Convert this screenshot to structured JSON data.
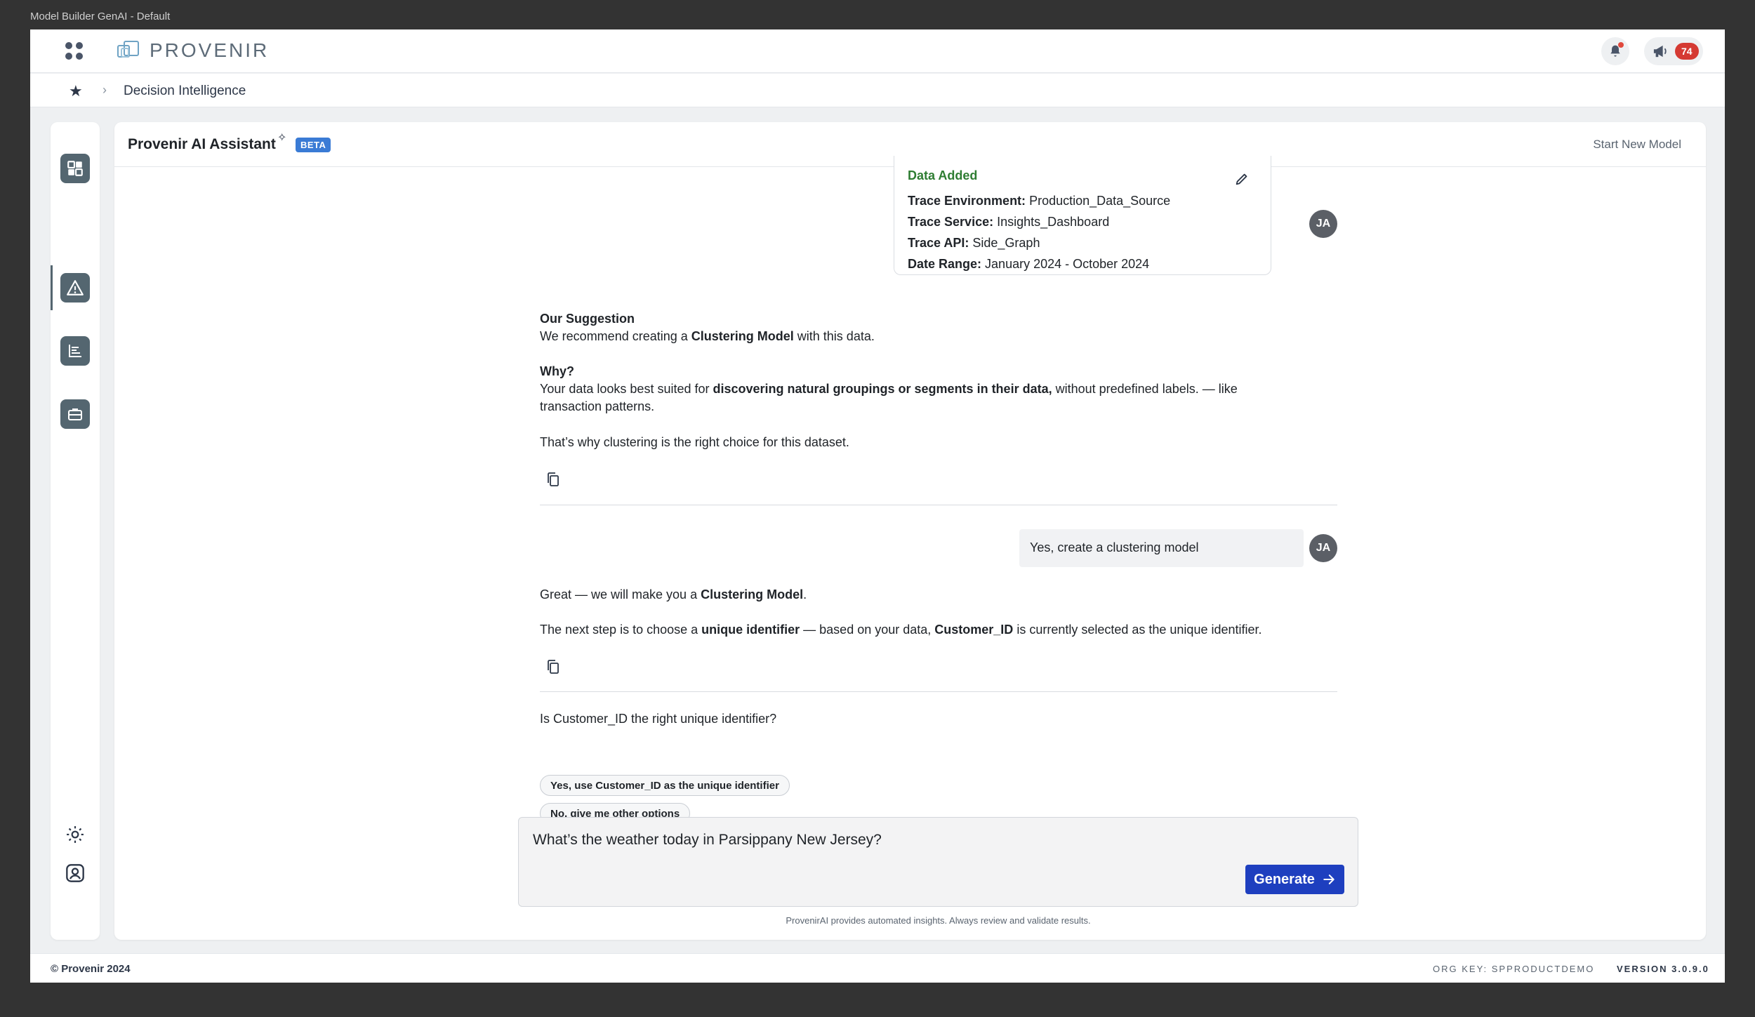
{
  "window": {
    "title": "Model Builder GenAI - Default"
  },
  "header": {
    "logo_text": "PROVENIR",
    "notification_count": "74"
  },
  "breadcrumb": {
    "item": "Decision Intelligence"
  },
  "panel": {
    "title": "Provenir AI Assistant",
    "beta_label": "BETA",
    "start_new_label": "Start New Model"
  },
  "data_card": {
    "title": "Data Added",
    "rows": [
      {
        "label": "Trace Environment:",
        "value": "Production_Data_Source"
      },
      {
        "label": "Trace Service:",
        "value": "Insights_Dashboard"
      },
      {
        "label": "Trace API:",
        "value": "Side_Graph"
      },
      {
        "label": "Date Range:",
        "value": "January 2024 - October 2024"
      }
    ]
  },
  "user": {
    "initials": "JA"
  },
  "suggestion": {
    "heading": "Our Suggestion",
    "line_pre": "We recommend creating a ",
    "line_bold": "Clustering Model",
    "line_post": " with this data.",
    "why_heading": "Why?",
    "why_pre": "Your data looks best suited for ",
    "why_bold": "discovering natural groupings or segments in their data,",
    "why_post": " without predefined labels. — like",
    "why_line2": "transaction patterns.",
    "conclusion": "That’s why clustering is the right choice for this dataset."
  },
  "user_message": "Yes, create a clustering model",
  "reply": {
    "line1_pre": "Great — we will make you a ",
    "line1_bold": "Clustering Model",
    "line1_post": ".",
    "line2_pre": "The next step is to choose a ",
    "line2_bold1": "unique identifier",
    "line2_mid": " — based on your data, ",
    "line2_bold2": "Customer_ID",
    "line2_post": " is currently selected as the unique identifier."
  },
  "question": "Is Customer_ID the right unique identifier?",
  "options": [
    "Yes, use Customer_ID as the unique identifier",
    "No, give me other options"
  ],
  "input": {
    "value": "What’s the weather today in Parsippany New Jersey?"
  },
  "generate_label": "Generate",
  "disclaimer": "ProvenirAI provides automated insights. Always review and validate results.",
  "footer": {
    "copyright": "© Provenir 2024",
    "org_key": "ORG KEY: SPPRODUCTDEMO",
    "version": "VERSION 3.0.9.0"
  },
  "icons": [
    "app-grid-icon",
    "bell-icon",
    "megaphone-icon",
    "star-icon",
    "chevron-right-icon",
    "sparkle-icon",
    "pencil-icon",
    "copy-icon",
    "arrow-right-icon",
    "sun-icon",
    "user-profile-icon"
  ]
}
